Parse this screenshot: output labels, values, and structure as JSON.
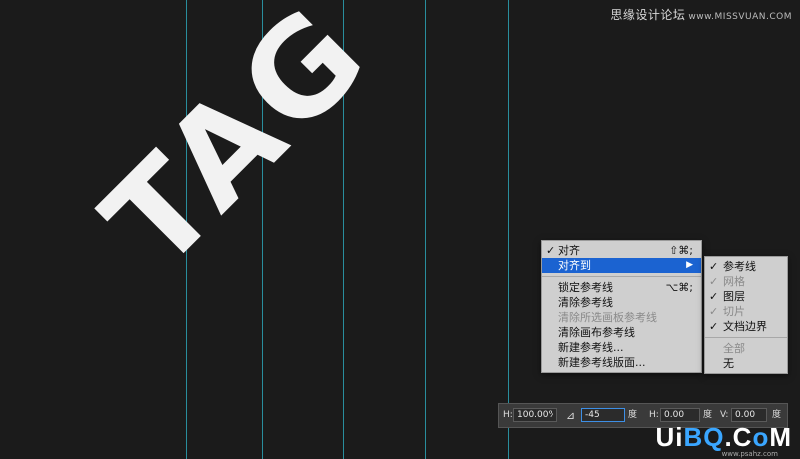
{
  "watermark_top": {
    "cn": "思缘设计论坛",
    "en": "www.MISSVUAN.COM"
  },
  "watermark_bottom": {
    "a": "Ui",
    "b": "BQ",
    "c": ".C",
    "d": "o",
    "e": "M",
    "sub": "www.psahz.com"
  },
  "artwork": {
    "text": "TAG"
  },
  "menu": {
    "items": [
      {
        "label": "对齐",
        "checked": "✓",
        "shortcut": "⇧⌘;"
      },
      {
        "label": "对齐到",
        "checked": "",
        "arrow": "▶"
      },
      {
        "label": "锁定参考线",
        "shortcut": "⌥⌘;"
      },
      {
        "label": "清除参考线"
      },
      {
        "label": "清除所选画板参考线"
      },
      {
        "label": "清除画布参考线"
      },
      {
        "label": "新建参考线..."
      },
      {
        "label": "新建参考线版面..."
      }
    ]
  },
  "submenu": {
    "items": [
      {
        "label": "参考线",
        "checked": "✓"
      },
      {
        "label": "网格",
        "checked": "✓"
      },
      {
        "label": "图层",
        "checked": "✓"
      },
      {
        "label": "切片",
        "checked": "✓"
      },
      {
        "label": "文档边界",
        "checked": "✓"
      },
      {
        "label": "全部"
      },
      {
        "label": "无"
      }
    ]
  },
  "options_bar": {
    "h_label": "H:",
    "h_value": "100.00%",
    "angle_icon": "angle-icon",
    "angle_value": "-45",
    "angle_unit": "度",
    "skew_h_label": "H:",
    "skew_h_value": "0.00",
    "skew_h_unit": "度",
    "skew_v_label": "V:",
    "skew_v_value": "0.00",
    "skew_v_unit": "度"
  }
}
